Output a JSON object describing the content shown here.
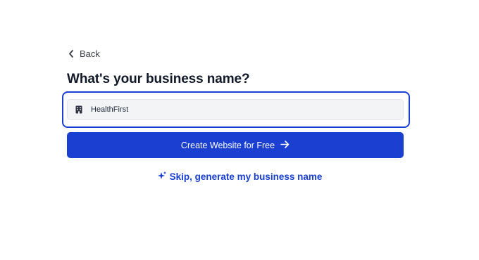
{
  "nav": {
    "back_label": "Back"
  },
  "form": {
    "title": "What's your business name?",
    "business_name_value": "HealthFirst",
    "submit_label": "Create Website for Free",
    "skip_label": "Skip, generate my business name"
  },
  "icons": {
    "back": "chevron-left-icon",
    "field": "building-icon",
    "submit": "arrow-right-icon",
    "skip": "sparkles-icon"
  },
  "colors": {
    "accent": "#1a3fd1",
    "title": "#111827",
    "input_bg": "#f3f4f6",
    "page_bg": "#ffffff"
  }
}
